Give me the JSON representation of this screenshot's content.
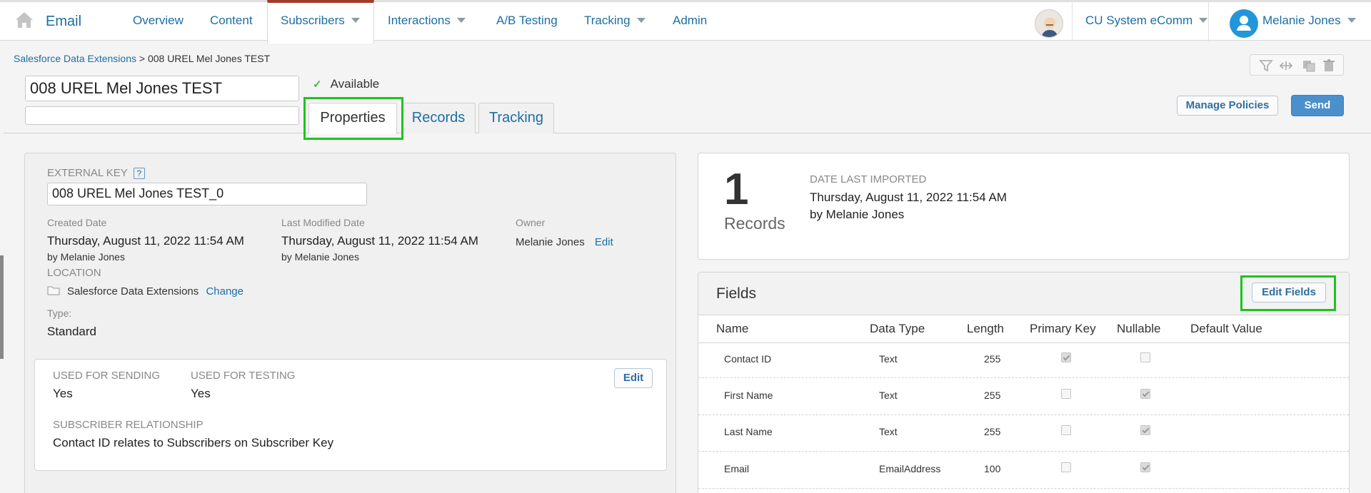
{
  "nav": {
    "brand": "Email",
    "items": [
      {
        "label": "Overview",
        "caret": false
      },
      {
        "label": "Content",
        "caret": false
      },
      {
        "label": "Subscribers",
        "caret": true
      },
      {
        "label": "Interactions",
        "caret": true
      },
      {
        "label": "A/B Testing",
        "caret": false
      },
      {
        "label": "Tracking",
        "caret": true
      },
      {
        "label": "Admin",
        "caret": false
      }
    ],
    "active": "Subscribers",
    "business_unit": "CU System eComm",
    "user": "Melanie Jones"
  },
  "header": {
    "breadcrumb_link": "Salesforce Data Extensions",
    "breadcrumb_sep": ">",
    "breadcrumb_current": "008 UREL Mel Jones TEST",
    "name_value": "008 UREL Mel Jones TEST",
    "description_value": "",
    "status": "Available",
    "tabs": [
      "Properties",
      "Records",
      "Tracking"
    ],
    "active_tab": "Properties",
    "manage_policies": "Manage Policies",
    "send": "Send"
  },
  "properties": {
    "external_key_label": "EXTERNAL KEY",
    "help": "?",
    "external_key_value": "008 UREL Mel Jones TEST_0",
    "created_label": "Created Date",
    "created_date": "Thursday, August 11, 2022 11:54 AM",
    "created_by": "by Melanie Jones",
    "modified_label": "Last Modified Date",
    "modified_date": "Thursday, August 11, 2022 11:54 AM",
    "modified_by": "by Melanie Jones",
    "owner_label": "Owner",
    "owner_value": "Melanie Jones",
    "owner_edit": "Edit",
    "location_label": "LOCATION",
    "location_value": "Salesforce Data Extensions",
    "location_change": "Change",
    "type_label": "Type:",
    "type_value": "Standard",
    "sending_label": "USED FOR SENDING",
    "sending_value": "Yes",
    "testing_label": "USED FOR TESTING",
    "testing_value": "Yes",
    "relationship_label": "SUBSCRIBER RELATIONSHIP",
    "relationship_value": "Contact ID relates to Subscribers on Subscriber Key",
    "edit": "Edit"
  },
  "records": {
    "count": "1",
    "count_label": "Records",
    "import_label": "DATE LAST IMPORTED",
    "import_date": "Thursday, August 11, 2022 11:54 AM",
    "import_by": "by Melanie Jones"
  },
  "fields": {
    "title": "Fields",
    "edit_fields": "Edit Fields",
    "columns": [
      "Name",
      "Data Type",
      "Length",
      "Primary Key",
      "Nullable",
      "Default Value"
    ],
    "rows": [
      {
        "name": "Contact ID",
        "type": "Text",
        "length": "255",
        "primary_key": true,
        "nullable": false
      },
      {
        "name": "First Name",
        "type": "Text",
        "length": "255",
        "primary_key": false,
        "nullable": true
      },
      {
        "name": "Last Name",
        "type": "Text",
        "length": "255",
        "primary_key": false,
        "nullable": true
      },
      {
        "name": "Email",
        "type": "EmailAddress",
        "length": "100",
        "primary_key": false,
        "nullable": true
      }
    ]
  },
  "colors": {
    "link": "#1c6ea4",
    "active_tab_bar": "#a23b2a",
    "highlight": "#1dc41d",
    "send_button": "#4a90cc"
  }
}
